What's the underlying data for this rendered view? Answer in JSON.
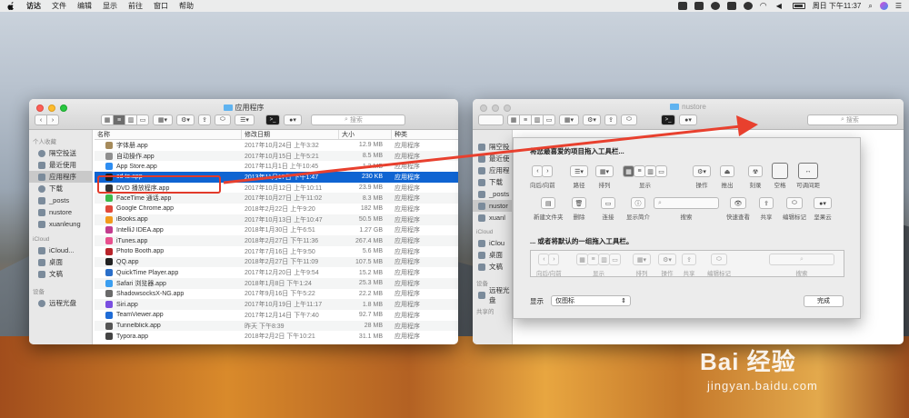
{
  "menubar": {
    "app_name": "访达",
    "items": [
      "文件",
      "编辑",
      "显示",
      "前往",
      "窗口",
      "帮助"
    ],
    "clock": "周日 下午11:37"
  },
  "finder_left": {
    "title": "应用程序",
    "search_placeholder": "搜索",
    "sidebar": {
      "sections": [
        {
          "label": "个人收藏",
          "items": [
            "隔空投送",
            "最近使用",
            "应用程序",
            "下载",
            "_posts",
            "nustore",
            "xuanleung"
          ]
        },
        {
          "label": "iCloud",
          "items": [
            "iCloud...",
            "桌面",
            "文稿"
          ]
        },
        {
          "label": "设备",
          "items": [
            "远程光盘"
          ]
        }
      ],
      "selected": "应用程序"
    },
    "columns": {
      "name": "名称",
      "date": "修改日期",
      "size": "大小",
      "kind": "种类"
    },
    "rows": [
      {
        "name": "字体册.app",
        "date": "2017年10月24日 上午3:32",
        "size": "12.9 MB",
        "kind": "应用程序",
        "color": "#a68b5b"
      },
      {
        "name": "自动操作.app",
        "date": "2017年10月15日 上午5:21",
        "size": "8.5 MB",
        "kind": "应用程序",
        "color": "#8f8f8f"
      },
      {
        "name": "App Store.app",
        "date": "2017年11月1日 上午10:45",
        "size": "1.3 MB",
        "kind": "应用程序",
        "color": "#2d8df1"
      },
      {
        "name": "cd to.app",
        "date": "2013年11月17日 下午1:47",
        "size": "230 KB",
        "kind": "应用程序",
        "color": "#1c1c1c",
        "selected": true
      },
      {
        "name": "DVD 播放程序.app",
        "date": "2017年10月12日 上午10:11",
        "size": "23.9 MB",
        "kind": "应用程序",
        "color": "#333333"
      },
      {
        "name": "FaceTime 通话.app",
        "date": "2017年10月27日 上午11:02",
        "size": "8.3 MB",
        "kind": "应用程序",
        "color": "#3cb94a"
      },
      {
        "name": "Google Chrome.app",
        "date": "2018年2月22日 上午9:20",
        "size": "182 MB",
        "kind": "应用程序",
        "color": "#e0483a"
      },
      {
        "name": "iBooks.app",
        "date": "2017年10月13日 上午10:47",
        "size": "50.5 MB",
        "kind": "应用程序",
        "color": "#f29a1c"
      },
      {
        "name": "IntelliJ IDEA.app",
        "date": "2018年1月30日 上午6:51",
        "size": "1.27 GB",
        "kind": "应用程序",
        "color": "#c23c8e"
      },
      {
        "name": "iTunes.app",
        "date": "2018年2月27日 下午11:36",
        "size": "267.4 MB",
        "kind": "应用程序",
        "color": "#e8508e"
      },
      {
        "name": "Photo Booth.app",
        "date": "2017年7月16日 上午9:50",
        "size": "5.6 MB",
        "kind": "应用程序",
        "color": "#b8242a"
      },
      {
        "name": "QQ.app",
        "date": "2018年2月27日 下午11:09",
        "size": "107.5 MB",
        "kind": "应用程序",
        "color": "#222222"
      },
      {
        "name": "QuickTime Player.app",
        "date": "2017年12月20日 上午9:54",
        "size": "15.2 MB",
        "kind": "应用程序",
        "color": "#2a6fc9"
      },
      {
        "name": "Safari 浏览器.app",
        "date": "2018年1月8日 下午1:24",
        "size": "25.3 MB",
        "kind": "应用程序",
        "color": "#3b9ef0"
      },
      {
        "name": "ShadowsocksX-NG.app",
        "date": "2017年9月16日 下午5:22",
        "size": "22.2 MB",
        "kind": "应用程序",
        "color": "#6a6a6a"
      },
      {
        "name": "Siri.app",
        "date": "2017年10月19日 上午11:17",
        "size": "1.8 MB",
        "kind": "应用程序",
        "color": "#7a4fe0"
      },
      {
        "name": "TeamViewer.app",
        "date": "2017年12月14日 下午7:40",
        "size": "92.7 MB",
        "kind": "应用程序",
        "color": "#1f6cd6"
      },
      {
        "name": "Tunnelblick.app",
        "date": "昨天 下午8:39",
        "size": "28 MB",
        "kind": "应用程序",
        "color": "#555555"
      },
      {
        "name": "Typora.app",
        "date": "2018年2月2日 下午10:21",
        "size": "31.1 MB",
        "kind": "应用程序",
        "color": "#444444"
      }
    ]
  },
  "finder_right": {
    "title": "nustore",
    "search_placeholder": "搜索",
    "sidebar": {
      "items": [
        "隔空投",
        "最近使",
        "应用程",
        "下载",
        "_posts",
        "nustor",
        "xuanl"
      ],
      "icloud_label": "iCloud",
      "icloud_items": [
        "iClou",
        "桌面",
        "文稿"
      ],
      "devices_label": "设备",
      "devices_items": [
        "远程光盘"
      ],
      "shared_label": "共享的"
    }
  },
  "customize": {
    "heading_drag": "将您最喜爱的项目拖入工具栏...",
    "palette_row1": [
      "向后/向前",
      "路径",
      "排列",
      "显示",
      "操作",
      "推出",
      "刻录",
      "空格",
      "可调间距"
    ],
    "palette_row2": [
      "新建文件夹",
      "删除",
      "连接",
      "显示简介",
      "搜索",
      "快速查看",
      "共享",
      "编辑标记",
      "坚果云"
    ],
    "heading_default": "... 或者将默认的一组拖入工具栏。",
    "default_labels": [
      "向后/向前",
      "显示",
      "排列",
      "操作",
      "共享",
      "编辑标记",
      "搜索"
    ],
    "show_label": "显示",
    "show_value": "仅图标",
    "done_label": "完成"
  },
  "watermark": {
    "line1": "Bai 经验",
    "line2": "jingyan.baidu.com"
  },
  "colors": {
    "selection": "#0f64d2",
    "highlight_box": "#e23a2a",
    "arrow": "#e8402e"
  }
}
